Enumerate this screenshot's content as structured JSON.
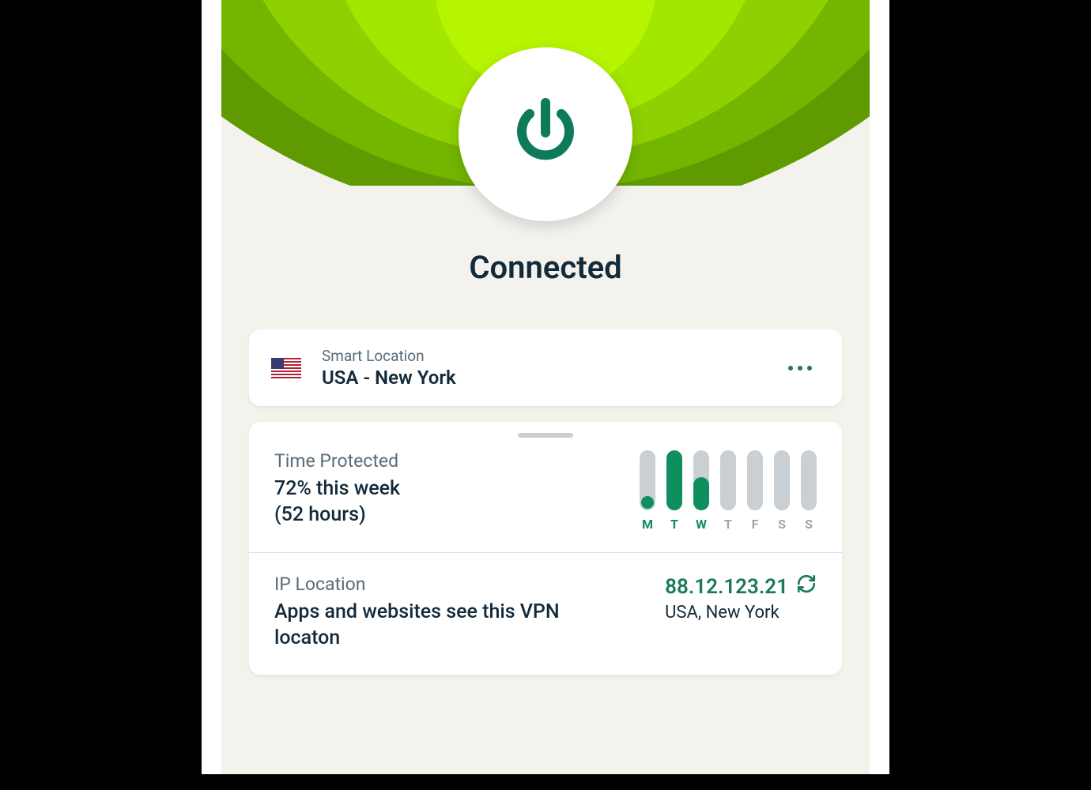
{
  "status": {
    "label": "Connected"
  },
  "location": {
    "smart_label": "Smart Location",
    "name": "USA - New York",
    "flag": "us"
  },
  "time_protected": {
    "label": "Time Protected",
    "summary_line1": "72% this week",
    "summary_line2": "(52 hours)"
  },
  "ip": {
    "label": "IP Location",
    "description": "Apps and websites see this VPN locaton",
    "address": "88.12.123.21",
    "location": "USA, New York"
  },
  "chart_data": {
    "type": "bar",
    "title": "Time Protected",
    "categories": [
      "M",
      "T",
      "W",
      "T",
      "F",
      "S",
      "S"
    ],
    "values": [
      15,
      100,
      55,
      0,
      0,
      0,
      0
    ],
    "ylim": [
      0,
      100
    ],
    "xlabel": "",
    "ylabel": ""
  },
  "colors": {
    "accent": "#0d8f5e",
    "accent_dark": "#1a7a5a",
    "text_dark": "#122a3a",
    "text_muted": "#5a6b77"
  }
}
